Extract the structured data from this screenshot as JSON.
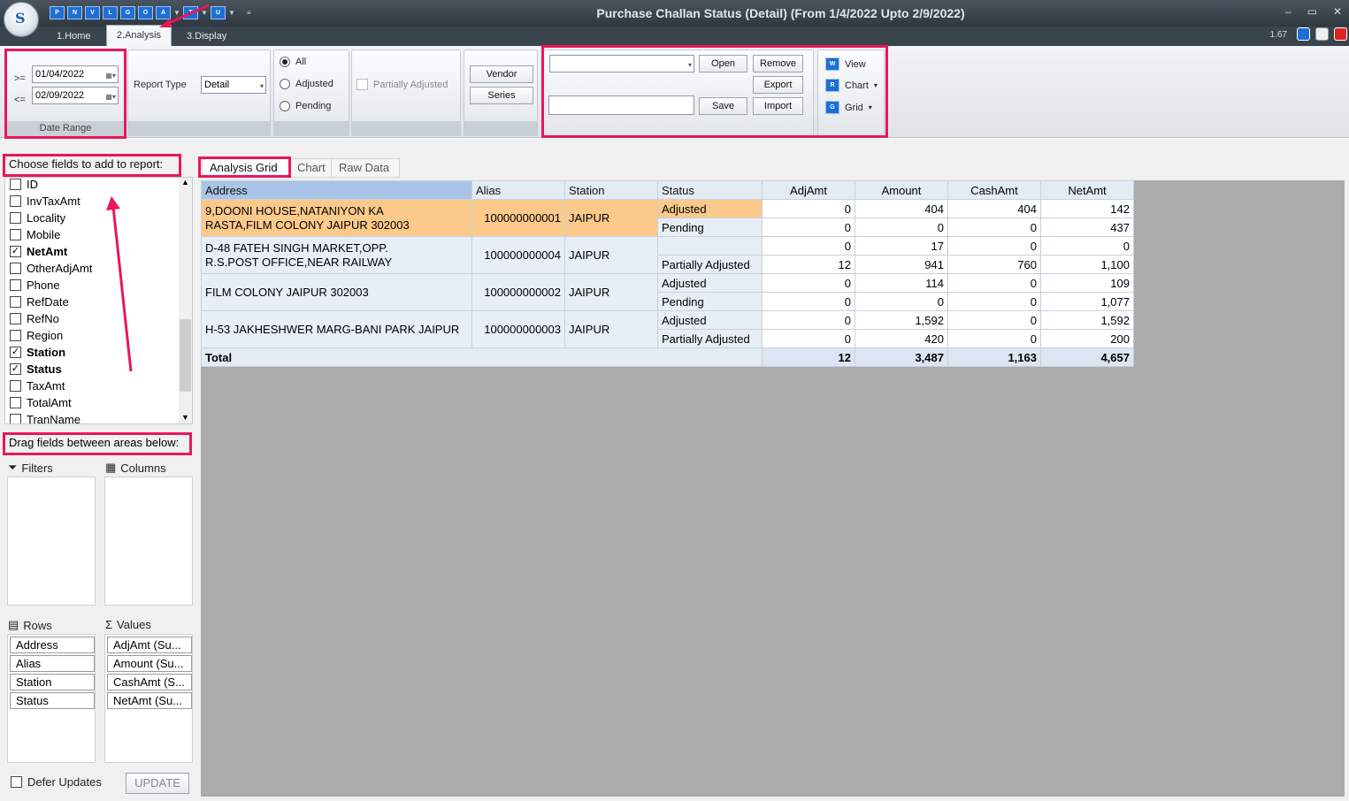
{
  "window": {
    "title": "Purchase Challan Status (Detail)  (From 1/4/2022 Upto 2/9/2022)",
    "version": "1.67"
  },
  "qat": [
    "P",
    "N",
    "V",
    "L",
    "G",
    "O",
    "A",
    "T",
    "U"
  ],
  "tabs": [
    "1.Home",
    "2.Analysis",
    "3.Display"
  ],
  "ribbon": {
    "date_from_op": ">=",
    "date_to_op": "<=",
    "date_from": "01/04/2022",
    "date_to": "02/09/2022",
    "date_group": "Date Range",
    "report_type_label": "Report Type",
    "report_type": "Detail",
    "radios": [
      "All",
      "Adjusted",
      "Pending"
    ],
    "partially_adjusted": "Partially Adjusted",
    "vendor": "Vendor",
    "series": "Series",
    "open": "Open",
    "remove": "Remove",
    "export": "Export",
    "save": "Save",
    "import": "Import",
    "view": "View",
    "chart": "Chart",
    "grid": "Grid"
  },
  "left": {
    "choose_label": "Choose fields to add to report:",
    "fields": [
      {
        "name": "ID",
        "checked": false
      },
      {
        "name": "InvTaxAmt",
        "checked": false
      },
      {
        "name": "Locality",
        "checked": false
      },
      {
        "name": "Mobile",
        "checked": false
      },
      {
        "name": "NetAmt",
        "checked": true
      },
      {
        "name": "OtherAdjAmt",
        "checked": false
      },
      {
        "name": "Phone",
        "checked": false
      },
      {
        "name": "RefDate",
        "checked": false
      },
      {
        "name": "RefNo",
        "checked": false
      },
      {
        "name": "Region",
        "checked": false
      },
      {
        "name": "Station",
        "checked": true
      },
      {
        "name": "Status",
        "checked": true
      },
      {
        "name": "TaxAmt",
        "checked": false
      },
      {
        "name": "TotalAmt",
        "checked": false
      },
      {
        "name": "TranName",
        "checked": false
      }
    ],
    "drag_label": "Drag fields between areas below:",
    "filters": "Filters",
    "columns": "Columns",
    "rows": "Rows",
    "values": "Values",
    "row_fields": [
      "Address",
      "Alias",
      "Station",
      "Status"
    ],
    "value_fields": [
      "AdjAmt (Su...",
      "Amount (Su...",
      "CashAmt (S...",
      "NetAmt (Su..."
    ],
    "defer": "Defer Updates",
    "update": "UPDATE"
  },
  "grid_tabs": [
    "Analysis Grid",
    "Chart",
    "Raw Data"
  ],
  "pivot": {
    "headers": [
      "Address",
      "Alias",
      "Station",
      "Status",
      "AdjAmt",
      "Amount",
      "CashAmt",
      "NetAmt"
    ],
    "groups": [
      {
        "address": [
          "9,DOONI HOUSE,NATANIYON KA",
          "RASTA,FILM COLONY JAIPUR 302003"
        ],
        "alias": "100000000001",
        "station": "JAIPUR",
        "rows": [
          [
            "Adjusted",
            "0",
            "404",
            "404",
            "142"
          ],
          [
            "Pending",
            "0",
            "0",
            "0",
            "437"
          ]
        ]
      },
      {
        "address": [
          "D-48 FATEH SINGH MARKET,OPP.",
          "R.S.POST OFFICE,NEAR RAILWAY"
        ],
        "alias": "100000000004",
        "station": "JAIPUR",
        "rows": [
          [
            "",
            "0",
            "17",
            "0",
            "0"
          ],
          [
            "Partially Adjusted",
            "12",
            "941",
            "760",
            "1,100"
          ]
        ]
      },
      {
        "address": [
          "FILM COLONY  JAIPUR 302003"
        ],
        "alias": "100000000002",
        "station": "JAIPUR",
        "rows": [
          [
            "Adjusted",
            "0",
            "114",
            "0",
            "109"
          ],
          [
            "Pending",
            "0",
            "0",
            "0",
            "1,077"
          ]
        ]
      },
      {
        "address": [
          "H-53 JAKHESHWER MARG-BANI PARK JAIPUR"
        ],
        "alias": "100000000003",
        "station": "JAIPUR",
        "rows": [
          [
            "Adjusted",
            "0",
            "1,592",
            "0",
            "1,592"
          ],
          [
            "Partially Adjusted",
            "0",
            "420",
            "0",
            "200"
          ]
        ]
      }
    ],
    "total_label": "Total",
    "totals": [
      "12",
      "3,487",
      "1,163",
      "4,657"
    ]
  }
}
